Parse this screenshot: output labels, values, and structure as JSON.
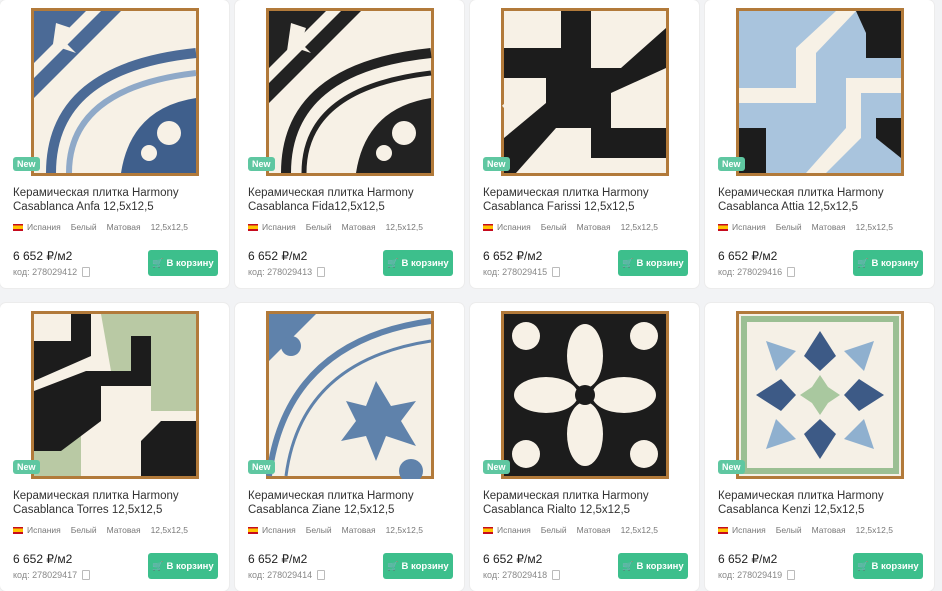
{
  "badge_label": "New",
  "cart_label": "В корзину",
  "code_prefix": "код:",
  "products": [
    {
      "title_line1": "Керамическая плитка Harmony",
      "title_line2": "Casablanca Anfa 12,5x12,5",
      "country": "Испания",
      "color": "Белый",
      "finish": "Матовая",
      "size": "12,5x12,5",
      "price": "6 652 ₽/м2",
      "code": "278029412"
    },
    {
      "title_line1": "Керамическая плитка Harmony",
      "title_line2": "Casablanca Fida12,5x12,5",
      "country": "Испания",
      "color": "Белый",
      "finish": "Матовая",
      "size": "12,5x12,5",
      "price": "6 652 ₽/м2",
      "code": "278029413"
    },
    {
      "title_line1": "Керамическая плитка Harmony",
      "title_line2": "Casablanca Farissi 12,5x12,5",
      "country": "Испания",
      "color": "Белый",
      "finish": "Матовая",
      "size": "12,5x12,5",
      "price": "6 652 ₽/м2",
      "code": "278029415"
    },
    {
      "title_line1": "Керамическая плитка Harmony",
      "title_line2": "Casablanca Attia 12,5x12,5",
      "country": "Испания",
      "color": "Белый",
      "finish": "Матовая",
      "size": "12,5x12,5",
      "price": "6 652 ₽/м2",
      "code": "278029416"
    },
    {
      "title_line1": "Керамическая плитка Harmony",
      "title_line2": "Casablanca Torres 12,5x12,5",
      "country": "Испания",
      "color": "Белый",
      "finish": "Матовая",
      "size": "12,5x12,5",
      "price": "6 652 ₽/м2",
      "code": "278029417"
    },
    {
      "title_line1": "Керамическая плитка Harmony",
      "title_line2": "Casablanca Ziane 12,5x12,5",
      "country": "Испания",
      "color": "Белый",
      "finish": "Матовая",
      "size": "12,5x12,5",
      "price": "6 652 ₽/м2",
      "code": "278029414"
    },
    {
      "title_line1": "Керамическая плитка Harmony",
      "title_line2": "Casablanca Rialto 12,5x12,5",
      "country": "Испания",
      "color": "Белый",
      "finish": "Матовая",
      "size": "12,5x12,5",
      "price": "6 652 ₽/м2",
      "code": "278029418"
    },
    {
      "title_line1": "Керамическая плитка Harmony",
      "title_line2": "Casablanca Kenzi 12,5x12,5",
      "country": "Испания",
      "color": "Белый",
      "finish": "Матовая",
      "size": "12,5x12,5",
      "price": "6 652 ₽/м2",
      "code": "278029419"
    }
  ],
  "colors": {
    "accent": "#3dbf8c",
    "badge": "#5fc7a1"
  }
}
